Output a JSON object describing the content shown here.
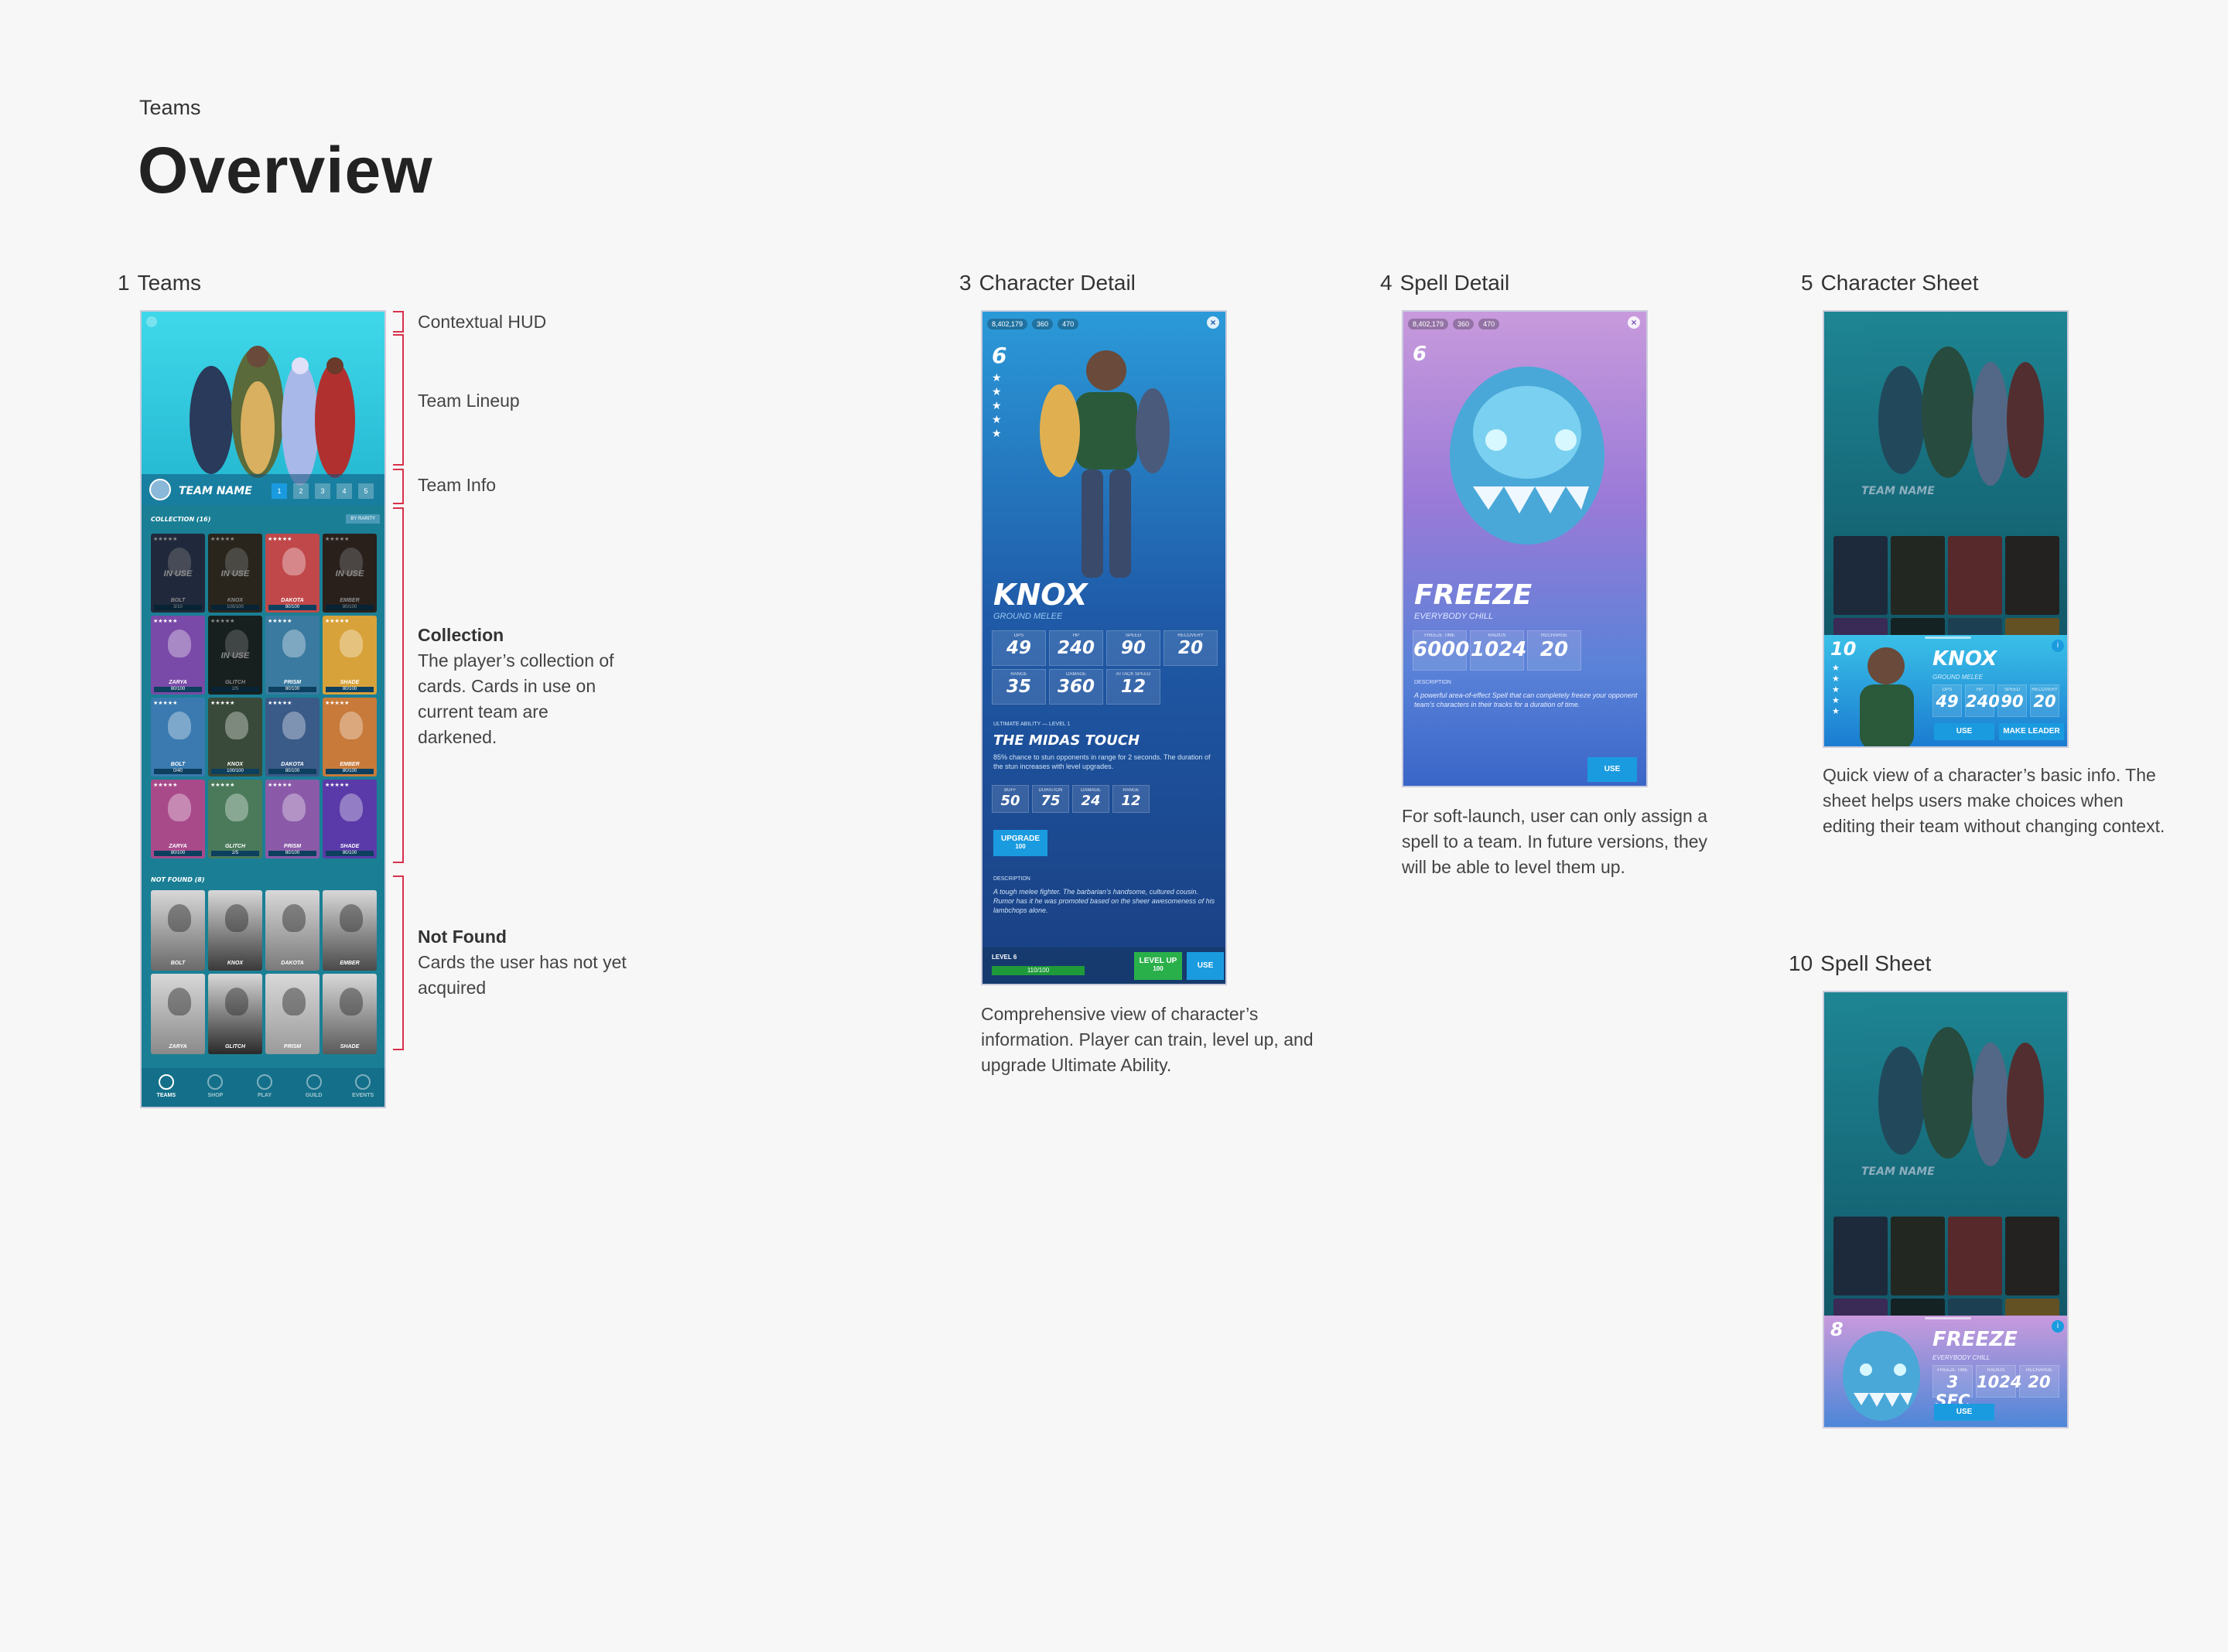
{
  "page": {
    "breadcrumb": "Teams",
    "title": "Overview"
  },
  "colors": {
    "accent": "#1a9be0",
    "bracket": "#d8304a",
    "teams_bg": "#1fb8d0",
    "detail_bg": "#1f5aa8",
    "spell_bg": "#b08ad8"
  },
  "sections": {
    "teams": {
      "num": "1",
      "label": "Teams"
    },
    "character_detail": {
      "num": "3",
      "label": "Character Detail"
    },
    "spell_detail": {
      "num": "4",
      "label": "Spell Detail"
    },
    "character_sheet": {
      "num": "5",
      "label": "Character Sheet"
    },
    "spell_sheet": {
      "num": "10",
      "label": "Spell Sheet"
    }
  },
  "annotations": {
    "hud": "Contextual HUD",
    "lineup": "Team Lineup",
    "info": "Team Info",
    "collection_title": "Collection",
    "collection_text": "The player’s collection of cards. Cards in use on current team are darkened.",
    "notfound_title": "Not Found",
    "notfound_text": "Cards the user has not yet acquired"
  },
  "descriptions": {
    "character_detail": "Comprehensive view of character’s information. Player can train, level up, and upgrade Ultimate Ability.",
    "spell_detail": "For soft-launch, user can only assign a spell to a team. In future versions, they will be able to level them up.",
    "character_sheet": "Quick view of a character’s basic info. The sheet helps users make choices when editing their team without changing context."
  },
  "teams_screen": {
    "team_name": "TEAM NAME",
    "team_slots": [
      "1",
      "2",
      "3",
      "4",
      "5"
    ],
    "collection_header": "COLLECTION (16)",
    "sort_button": "BY RARITY",
    "in_use": "IN USE",
    "collection_cards": [
      {
        "name": "BOLT",
        "bar": "3/10",
        "color": "#3b4a6b",
        "in_use": true
      },
      {
        "name": "KNOX",
        "bar": "100/100",
        "color": "#4a4434",
        "in_use": true
      },
      {
        "name": "DAKOTA",
        "bar": "80/100",
        "color": "#c0484a",
        "in_use": false
      },
      {
        "name": "EMBER",
        "bar": "80/100",
        "color": "#4a3a32",
        "in_use": true
      },
      {
        "name": "ZARYA",
        "bar": "80/100",
        "color": "#7a4aa8",
        "in_use": false
      },
      {
        "name": "GLITCH",
        "bar": "2/5",
        "color": "#2a3a38",
        "in_use": true
      },
      {
        "name": "PRISM",
        "bar": "80/100",
        "color": "#3a7aa0",
        "in_use": false
      },
      {
        "name": "SHADE",
        "bar": "80/100",
        "color": "#d8a23a",
        "in_use": false
      },
      {
        "name": "BOLT",
        "bar": "0/40",
        "color": "#3a7ab0",
        "in_use": false
      },
      {
        "name": "KNOX",
        "bar": "100/100",
        "color": "#3a4a3a",
        "in_use": false
      },
      {
        "name": "DAKOTA",
        "bar": "80/100",
        "color": "#3a5a88",
        "in_use": false
      },
      {
        "name": "EMBER",
        "bar": "80/100",
        "color": "#c87a3a",
        "in_use": false
      },
      {
        "name": "ZARYA",
        "bar": "80/100",
        "color": "#a84a8a",
        "in_use": false
      },
      {
        "name": "GLITCH",
        "bar": "2/5",
        "color": "#4a7a5a",
        "in_use": false
      },
      {
        "name": "PRISM",
        "bar": "80/100",
        "color": "#8a5aa8",
        "in_use": false
      },
      {
        "name": "SHADE",
        "bar": "80/100",
        "color": "#5a3aa8",
        "in_use": false
      }
    ],
    "notfound_header": "NOT FOUND (8)",
    "notfound_cards": [
      "BOLT",
      "KNOX",
      "DAKOTA",
      "EMBER",
      "ZARYA",
      "GLITCH",
      "PRISM",
      "SHADE"
    ],
    "nav": [
      "TEAMS",
      "SHOP",
      "PLAY",
      "GUILD",
      "EVENTS"
    ]
  },
  "hud": {
    "coins": "8,402,179",
    "gems": "360",
    "tickets": "470"
  },
  "character_detail": {
    "level": "6",
    "name": "KNOX",
    "role": "GROUND MELEE",
    "stats": [
      {
        "label": "DPS",
        "value": "49"
      },
      {
        "label": "HP",
        "value": "240"
      },
      {
        "label": "SPEED",
        "value": "90"
      },
      {
        "label": "RECOVERY",
        "value": "20"
      },
      {
        "label": "RANGE",
        "value": "35"
      },
      {
        "label": "DAMAGE",
        "value": "360"
      },
      {
        "label": "ATTACK SPEED",
        "value": "12"
      }
    ],
    "ability_header": "ULTIMATE ABILITY — LEVEL 1",
    "ability_name": "THE MIDAS TOUCH",
    "ability_text": "85% chance to stun opponents in range for 2 seconds. The duration of the stun increases with level upgrades.",
    "ability_stats": [
      {
        "label": "BUFF",
        "value": "50"
      },
      {
        "label": "DURATION",
        "value": "75"
      },
      {
        "label": "DAMAGE",
        "value": "24"
      },
      {
        "label": "RANGE",
        "value": "12"
      }
    ],
    "upgrade": "UPGRADE",
    "upgrade_cost": "100",
    "description_header": "DESCRIPTION",
    "description": "A tough melee fighter. The barbarian’s handsome, cultured cousin. Rumor has it he was promoted based on the sheer awesomeness of his lambchops alone.",
    "level_label": "LEVEL 6",
    "xp": "110/100",
    "level_up": "LEVEL UP",
    "level_up_cost": "100",
    "use": "USE"
  },
  "spell_detail": {
    "level": "6",
    "name": "FREEZE",
    "subtitle": "EVERYBODY CHILL",
    "stats": [
      {
        "label": "FREEZE TIME",
        "value": "6000"
      },
      {
        "label": "RADIUS",
        "value": "1024"
      },
      {
        "label": "RECHARGE",
        "value": "20"
      }
    ],
    "description_header": "DESCRIPTION",
    "description": "A powerful area-of-effect Spell that can completely freeze your opponent team’s characters in their tracks for a duration of time.",
    "use": "USE"
  },
  "character_sheet": {
    "level": "10",
    "name": "KNOX",
    "role": "GROUND MELEE",
    "stats": [
      {
        "label": "DPS",
        "value": "49"
      },
      {
        "label": "HP",
        "value": "240"
      },
      {
        "label": "SPEED",
        "value": "90"
      },
      {
        "label": "RECOVERY",
        "value": "20"
      }
    ],
    "use": "USE",
    "make_leader": "MAKE LEADER"
  },
  "spell_sheet": {
    "level": "8",
    "name": "FREEZE",
    "subtitle": "EVERYBODY CHILL",
    "stats": [
      {
        "label": "FREEZE TIME",
        "value": "3 SEC"
      },
      {
        "label": "RADIUS",
        "value": "1024"
      },
      {
        "label": "RECHARGE",
        "value": "20"
      }
    ],
    "use": "USE"
  }
}
